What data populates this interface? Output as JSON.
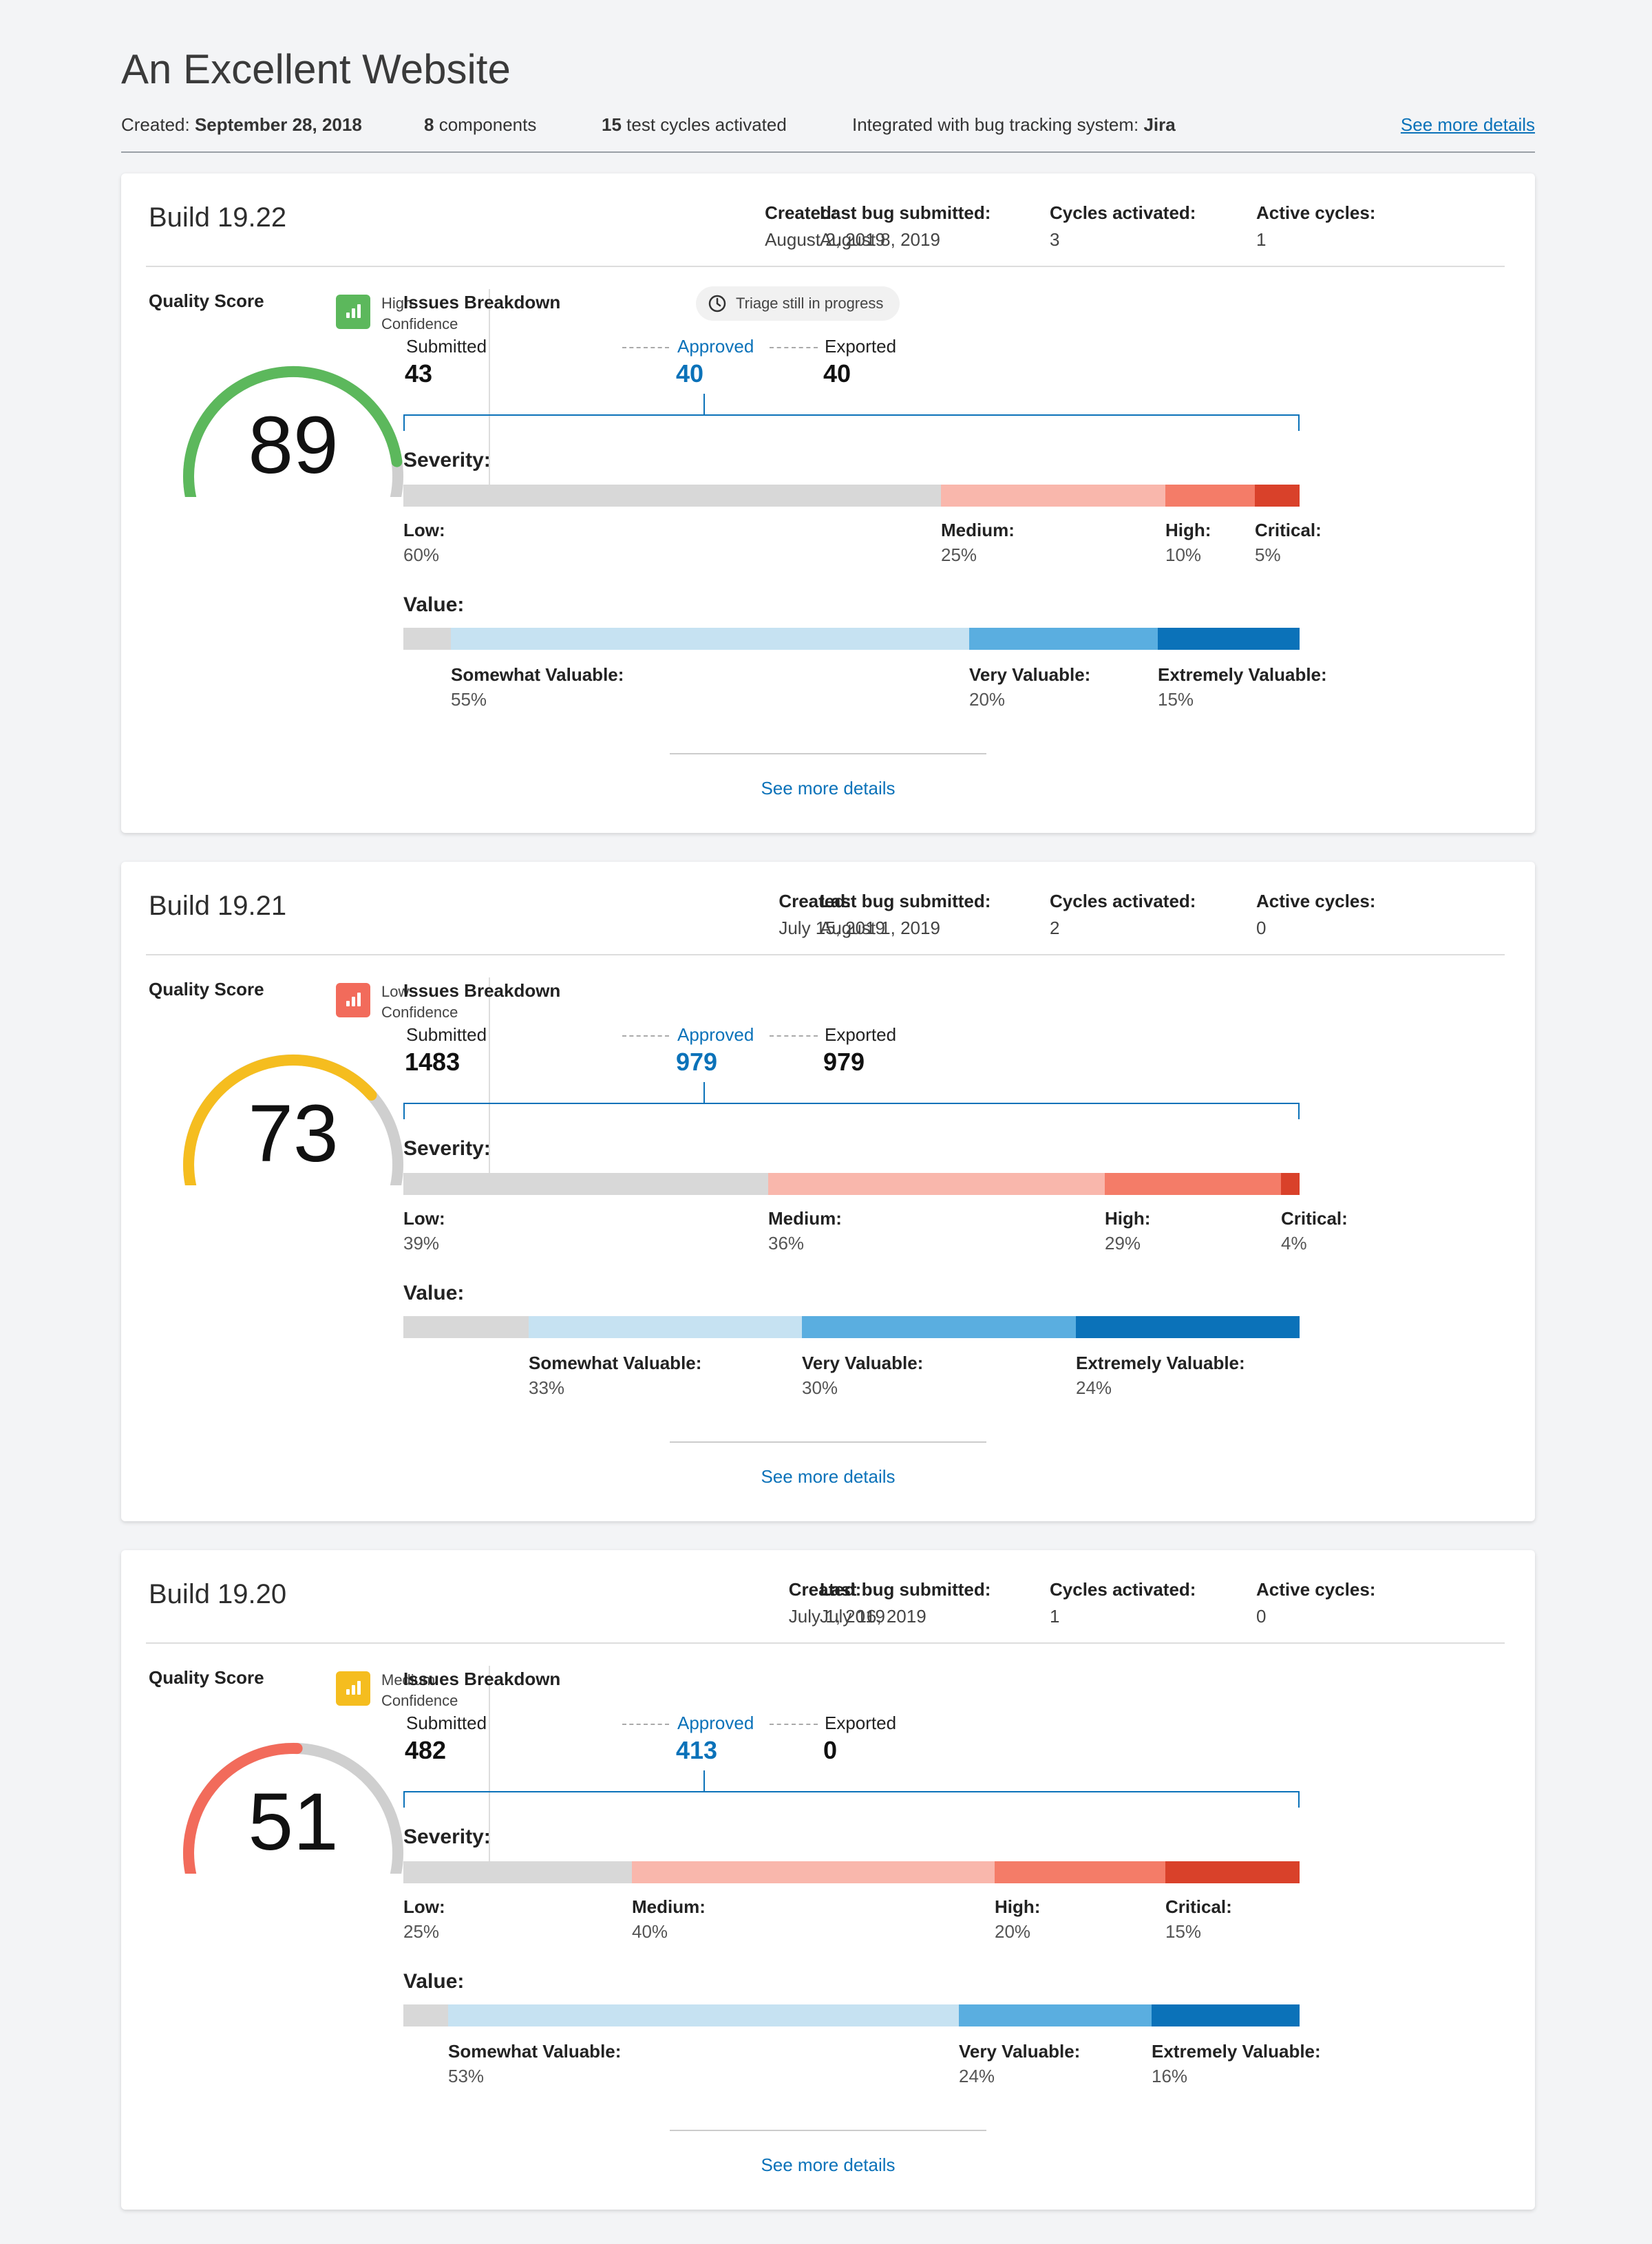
{
  "site": {
    "title": "An Excellent Website",
    "created_label": "Created:",
    "created_value": "September 28, 2018",
    "components_count": "8",
    "components_label": "components",
    "cycles_count": "15",
    "cycles_label": "test cycles activated",
    "integration_label": "Integrated with bug tracking system:",
    "integration_value": "Jira",
    "details_link": "See more details"
  },
  "colors": {
    "accent": "#0b72b9",
    "gauge_high": "#5cb85c",
    "gauge_medium": "#f5bd1f",
    "gauge_low": "#f26b5b",
    "gauge_track": "#cfcfcf",
    "sev_low": "#d8d8d8",
    "sev_medium": "#f9b7ac",
    "sev_high": "#f47c68",
    "sev_critical": "#d9412a",
    "val_none": "#d8d8d8",
    "val_somewhat": "#c6e2f2",
    "val_very": "#5aaee0",
    "val_extremely": "#0b72b9"
  },
  "builds": [
    {
      "title": "Build 19.22",
      "created_label": "Created:",
      "created": "August 2, 2019",
      "last_bug_label": "Last bug submitted:",
      "last_bug": "August 8, 2019",
      "cycles_label": "Cycles activated:",
      "cycles": "3",
      "active_label": "Active cycles:",
      "active": "1",
      "quality_label": "Quality Score",
      "score": "89",
      "score_value": 89,
      "gauge_color": "#5cb85c",
      "confidence_level": "High",
      "confidence_label": "Confidence",
      "confidence_color": "#5cb85c",
      "confidence_icon": "bar-chart-icon",
      "issues_label": "Issues Breakdown",
      "triage": "Triage still in progress",
      "triage_icon": "clock-icon",
      "submitted_label": "Submitted",
      "submitted": "43",
      "approved_label": "Approved",
      "approved": "40",
      "exported_label": "Exported",
      "exported": "40",
      "severity_title": "Severity:",
      "severity": [
        {
          "label": "Low:",
          "pct": "60%",
          "value": 60,
          "color": "#d8d8d8"
        },
        {
          "label": "Medium:",
          "pct": "25%",
          "value": 25,
          "color": "#f9b7ac"
        },
        {
          "label": "High:",
          "pct": "10%",
          "value": 10,
          "color": "#f47c68"
        },
        {
          "label": "Critical:",
          "pct": "5%",
          "value": 5,
          "color": "#d9412a"
        }
      ],
      "value_title": "Value:",
      "value": [
        {
          "label": "",
          "pct": "",
          "value": 5,
          "color": "#d8d8d8"
        },
        {
          "label": "Somewhat Valuable:",
          "pct": "55%",
          "value": 55,
          "color": "#c6e2f2"
        },
        {
          "label": "Very Valuable:",
          "pct": "20%",
          "value": 20,
          "color": "#5aaee0"
        },
        {
          "label": "Extremely Valuable:",
          "pct": "15%",
          "value": 15,
          "color": "#0b72b9"
        }
      ],
      "more_link": "See more details"
    },
    {
      "title": "Build 19.21",
      "created_label": "Created:",
      "created": "July 15, 2019",
      "last_bug_label": "Last bug submitted:",
      "last_bug": "August 1, 2019",
      "cycles_label": "Cycles activated:",
      "cycles": "2",
      "active_label": "Active cycles:",
      "active": "0",
      "quality_label": "Quality Score",
      "score": "73",
      "score_value": 73,
      "gauge_color": "#f5bd1f",
      "confidence_level": "Low",
      "confidence_label": "Confidence",
      "confidence_color": "#f26b5b",
      "confidence_icon": "bar-chart-icon",
      "issues_label": "Issues Breakdown",
      "triage": "",
      "triage_icon": "",
      "submitted_label": "Submitted",
      "submitted": "1483",
      "approved_label": "Approved",
      "approved": "979",
      "exported_label": "Exported",
      "exported": "979",
      "severity_title": "Severity:",
      "severity": [
        {
          "label": "Low:",
          "pct": "39%",
          "value": 39,
          "color": "#d8d8d8"
        },
        {
          "label": "Medium:",
          "pct": "36%",
          "value": 36,
          "color": "#f9b7ac"
        },
        {
          "label": "High:",
          "pct": "29%",
          "value": 18.8,
          "color": "#f47c68"
        },
        {
          "label": "Critical:",
          "pct": "4%",
          "value": 2,
          "color": "#d9412a"
        }
      ],
      "value_title": "Value:",
      "value": [
        {
          "label": "",
          "pct": "",
          "value": 14,
          "color": "#d8d8d8"
        },
        {
          "label": "Somewhat Valuable:",
          "pct": "33%",
          "value": 30.5,
          "color": "#c6e2f2"
        },
        {
          "label": "Very Valuable:",
          "pct": "30%",
          "value": 30.5,
          "color": "#5aaee0"
        },
        {
          "label": "Extremely Valuable:",
          "pct": "24%",
          "value": 25,
          "color": "#0b72b9"
        }
      ],
      "more_link": "See more details"
    },
    {
      "title": "Build 19.20",
      "created_label": "Created:",
      "created": "July 1, 2019",
      "last_bug_label": "Last bug submitted:",
      "last_bug": "July 16, 2019",
      "cycles_label": "Cycles activated:",
      "cycles": "1",
      "active_label": "Active cycles:",
      "active": "0",
      "quality_label": "Quality Score",
      "score": "51",
      "score_value": 51,
      "gauge_color": "#f26b5b",
      "confidence_level": "Medium",
      "confidence_label": "Confidence",
      "confidence_color": "#f5bd1f",
      "confidence_icon": "bar-chart-icon",
      "issues_label": "Issues Breakdown",
      "triage": "",
      "triage_icon": "",
      "submitted_label": "Submitted",
      "submitted": "482",
      "approved_label": "Approved",
      "approved": "413",
      "exported_label": "Exported",
      "exported": "0",
      "severity_title": "Severity:",
      "severity": [
        {
          "label": "Low:",
          "pct": "25%",
          "value": 25.5,
          "color": "#d8d8d8"
        },
        {
          "label": "Medium:",
          "pct": "40%",
          "value": 40.5,
          "color": "#f9b7ac"
        },
        {
          "label": "High:",
          "pct": "20%",
          "value": 19,
          "color": "#f47c68"
        },
        {
          "label": "Critical:",
          "pct": "15%",
          "value": 15,
          "color": "#d9412a"
        }
      ],
      "value_title": "Value:",
      "value": [
        {
          "label": "",
          "pct": "",
          "value": 5,
          "color": "#d8d8d8"
        },
        {
          "label": "Somewhat Valuable:",
          "pct": "53%",
          "value": 57,
          "color": "#c6e2f2"
        },
        {
          "label": "Very Valuable:",
          "pct": "24%",
          "value": 21.5,
          "color": "#5aaee0"
        },
        {
          "label": "Extremely Valuable:",
          "pct": "16%",
          "value": 16.5,
          "color": "#0b72b9"
        }
      ],
      "more_link": "See more details"
    }
  ]
}
